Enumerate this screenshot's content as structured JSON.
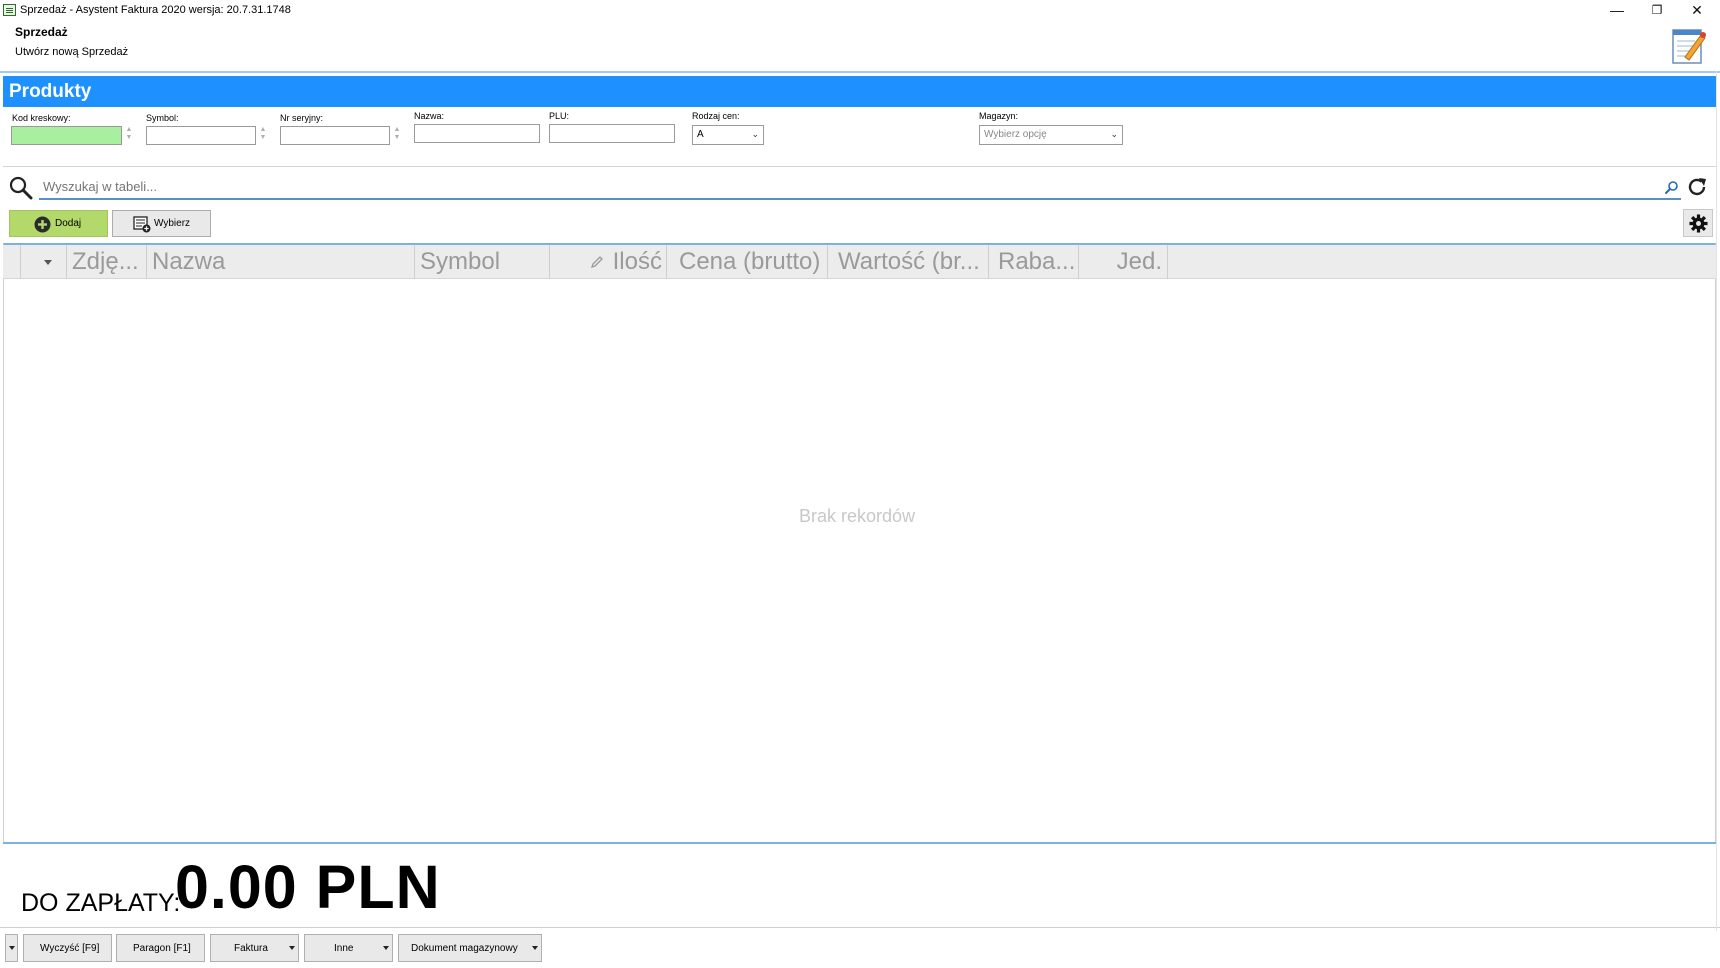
{
  "window": {
    "title": "Sprzedaż - Asystent Faktura 2020 wersja: 20.7.31.1748",
    "minimize": "—",
    "restore": "❐",
    "close": "✕"
  },
  "header": {
    "title": "Sprzedaż",
    "subtitle": "Utwórz nową Sprzedaż"
  },
  "banner": {
    "title": "Produkty",
    "color": "#1e90ff"
  },
  "filters": {
    "barcode_label": "Kod kreskowy:",
    "barcode_value": "",
    "symbol_label": "Symbol:",
    "symbol_value": "",
    "serial_label": "Nr seryjny:",
    "serial_value": "",
    "name_label": "Nazwa:",
    "name_value": "",
    "plu_label": "PLU:",
    "plu_value": "",
    "price_type_label": "Rodzaj cen:",
    "price_type_value": "A",
    "warehouse_label": "Magazyn:",
    "warehouse_placeholder": "Wybierz opcję"
  },
  "search": {
    "placeholder": "Wyszukaj w tabeli..."
  },
  "toolbar": {
    "add_label": "Dodaj",
    "select_label": "Wybierz"
  },
  "grid": {
    "columns": [
      "Zdję...",
      "Nazwa",
      "Symbol",
      "Ilość",
      "Cena (brutto)",
      "Wartość (br...",
      "Raba...",
      "Jed."
    ],
    "empty_text": "Brak rekordów"
  },
  "total": {
    "label": "DO ZAPŁATY:",
    "value": "0.00 PLN"
  },
  "bottom_buttons": {
    "clear": "Wyczyść [F9]",
    "receipt": "Paragon [F1]",
    "invoice": "Faktura",
    "other": "Inne",
    "warehouse_doc": "Dokument magazynowy"
  },
  "colors": {
    "accent": "#1e90ff",
    "add_button": "#b3d96b",
    "barcode_field": "#a8f0a0"
  }
}
